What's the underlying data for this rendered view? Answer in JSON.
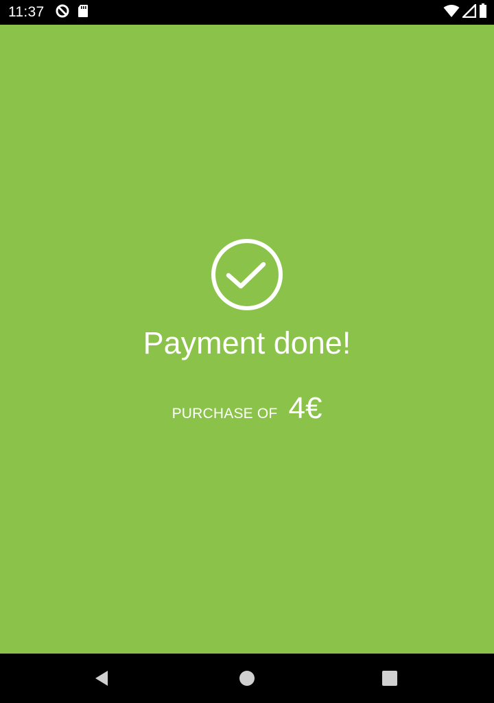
{
  "status_bar": {
    "time": "11:37",
    "left_icons": [
      "data-saver-icon",
      "sd-card-icon"
    ],
    "right_icons": [
      "wifi-icon",
      "cell-signal-icon",
      "battery-icon"
    ]
  },
  "payment": {
    "title": "Payment done!",
    "purchase_label": "PURCHASE OF",
    "amount": "4€"
  },
  "nav_bar": {
    "buttons": [
      "back-icon",
      "home-icon",
      "recents-icon"
    ]
  },
  "colors": {
    "background": "#8bc34a",
    "foreground": "#ffffff",
    "system_bars": "#000000"
  }
}
